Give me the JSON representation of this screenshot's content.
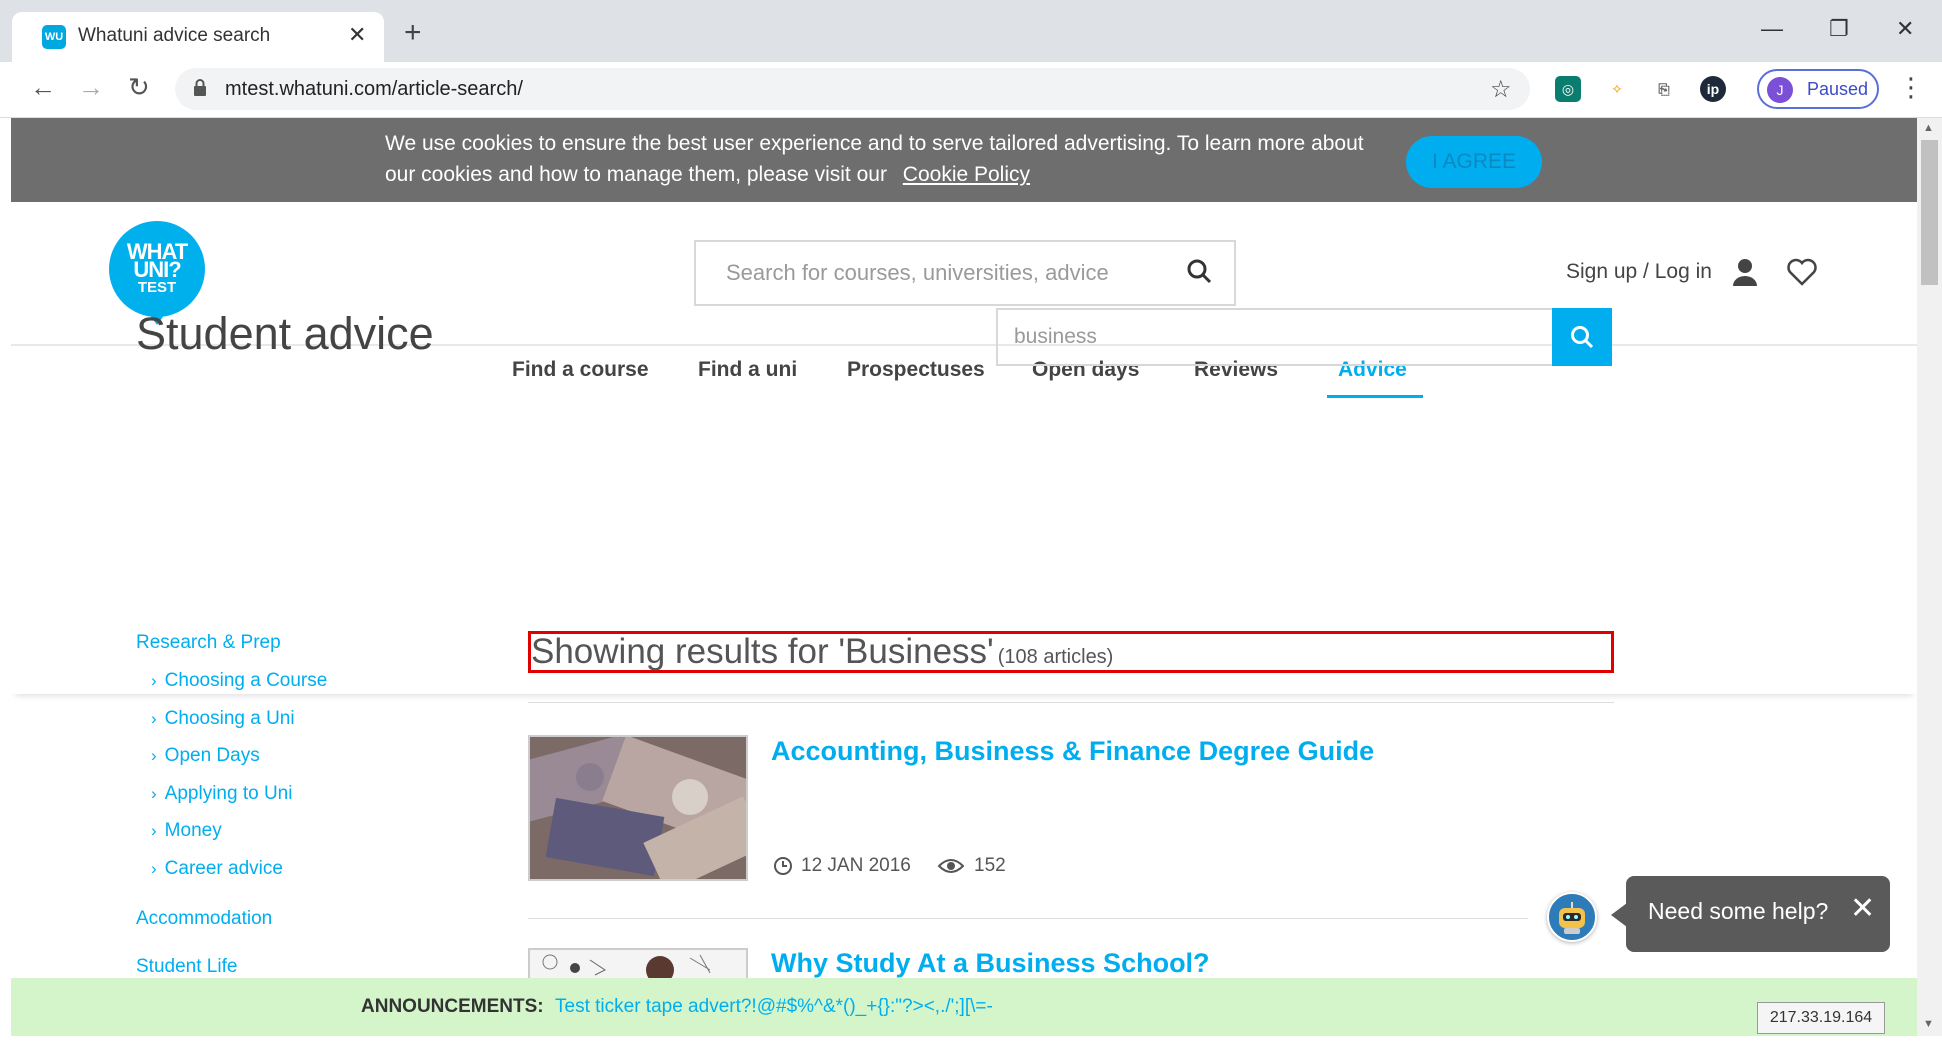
{
  "browser": {
    "tab_title": "Whatuni advice search",
    "favicon_text": "WU",
    "url": "mtest.whatuni.com/article-search/",
    "profile_initial": "J",
    "profile_status": "Paused"
  },
  "cookie_banner": {
    "text": "We use cookies to ensure the best user experience and to serve tailored advertising. To learn more about our cookies and how to manage them, please visit our",
    "link": "Cookie Policy",
    "button": "I AGREE"
  },
  "header": {
    "logo_line1": "WHAT",
    "logo_line2": "UNI?",
    "logo_line3": "TEST",
    "search_placeholder": "Search for courses, universities, advice",
    "signup_label": "Sign up / Log in"
  },
  "nav": {
    "items": [
      "Find a course",
      "Find a uni",
      "Prospectuses",
      "Open days",
      "Reviews",
      "Advice"
    ],
    "active": "Advice"
  },
  "advice": {
    "title": "Student advice",
    "search_value": "business"
  },
  "sidebar": {
    "section1": "Research & Prep",
    "sub": [
      "Choosing a Course",
      "Choosing a Uni",
      "Open Days",
      "Applying to Uni",
      "Money",
      "Career advice"
    ],
    "section2": "Accommodation",
    "section3": "Student Life"
  },
  "results": {
    "heading": "Showing results for 'Business'",
    "count": "(108 articles)",
    "articles": [
      {
        "title": "Accounting, Business & Finance Degree Guide",
        "date": "12 JAN 2016",
        "views": "152"
      },
      {
        "title": "Why Study At a Business School?"
      }
    ]
  },
  "help": {
    "label": "Need some help?"
  },
  "ticker": {
    "label": "ANNOUNCEMENTS:",
    "text": "Test ticker tape advert?!@#$%^&*()_+{}:\"?><,./';][\\=-"
  },
  "ip_address": "217.33.19.164",
  "colors": {
    "accent": "#00aeef",
    "cookie_bg": "#6e6e6e",
    "ticker_bg": "#d4f5c9",
    "highlight_box": "#e00000"
  }
}
